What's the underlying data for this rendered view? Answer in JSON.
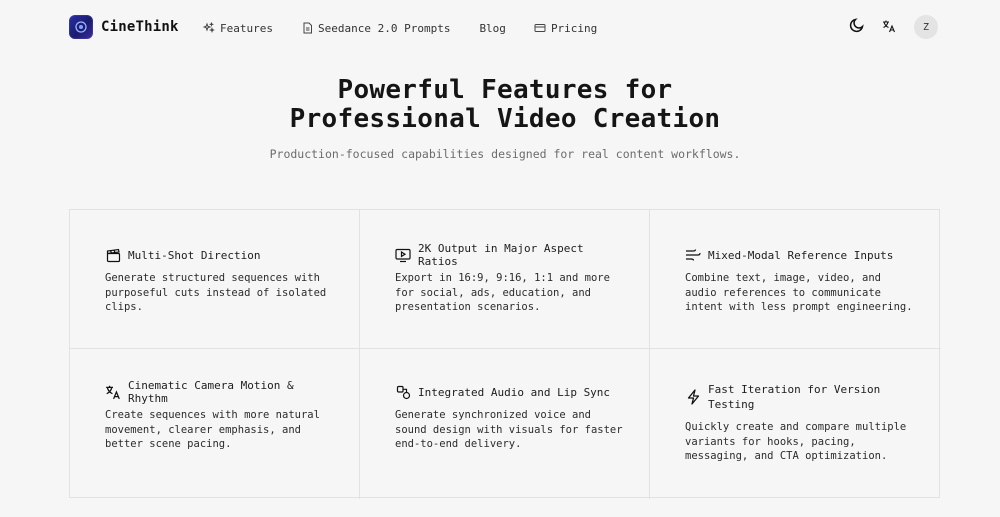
{
  "header": {
    "brand": "CineThink",
    "nav": [
      {
        "label": "Features",
        "icon": "sparkles-icon"
      },
      {
        "label": "Seedance 2.0 Prompts",
        "icon": "document-icon"
      },
      {
        "label": "Blog",
        "icon": ""
      },
      {
        "label": "Pricing",
        "icon": "credit-card-icon"
      }
    ],
    "theme_toggle_icon": "moon-icon",
    "language_icon": "translate-icon",
    "avatar_initial": "Z"
  },
  "hero": {
    "title_line1": "Powerful Features for",
    "title_line2": "Professional Video Creation",
    "subtitle": "Production-focused capabilities designed for real content workflows."
  },
  "features": [
    {
      "icon": "clapperboard-icon",
      "title": "Multi-Shot Direction",
      "body": "Generate structured sequences with purposeful cuts instead of isolated clips."
    },
    {
      "icon": "monitor-play-icon",
      "title": "2K Output in Major Aspect Ratios",
      "body": "Export in 16:9, 9:16, 1:1 and more for social, ads, education, and presentation scenarios."
    },
    {
      "icon": "mixed-lines-icon",
      "title": "Mixed-Modal Reference Inputs",
      "body": "Combine text, image, video, and audio references to communicate intent with less prompt engineering."
    },
    {
      "icon": "translate-icon",
      "title": "Cinematic Camera Motion & Rhythm",
      "body": "Create sequences with more natural movement, clearer emphasis, and better scene pacing."
    },
    {
      "icon": "shapes-icon",
      "title": "Integrated Audio and Lip Sync",
      "body": "Generate synchronized voice and sound design with visuals for faster end-to-end delivery."
    },
    {
      "icon": "lightning-icon",
      "title": "Fast Iteration for Version Testing",
      "body": "Quickly create and compare multiple variants for hooks, pacing, messaging, and CTA optimization."
    }
  ],
  "colors": {
    "background": "#f6f6f6",
    "border": "#e2e2e2",
    "text": "#1c1c1c",
    "muted": "#6c6c6c",
    "brand": "#2b2fa8"
  }
}
